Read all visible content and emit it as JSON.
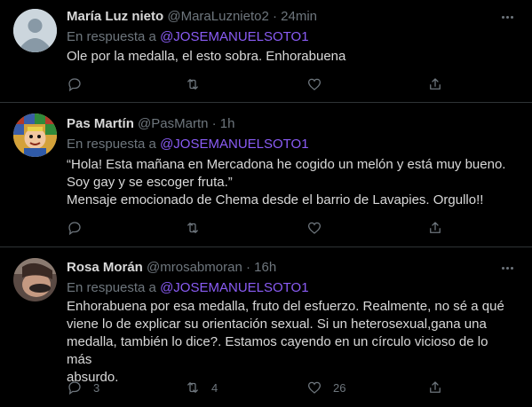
{
  "tweets": [
    {
      "name": "María Luz nieto",
      "handle": "@MaraLuznieto2",
      "separator": "·",
      "time": "24min",
      "reply_prefix": "En respuesta a",
      "reply_mention": "@JOSEMANUELSOTO1",
      "text_lines": [
        "Ole por la medalla, el esto sobra. Enhorabuena"
      ],
      "counts": {
        "reply": "",
        "retweet": "",
        "like": ""
      }
    },
    {
      "name": "Pas Martín",
      "handle": "@PasMartn",
      "separator": "·",
      "time": "1h",
      "reply_prefix": "En respuesta a",
      "reply_mention": "@JOSEMANUELSOTO1",
      "text_lines": [
        "“Hola! Esta mañana en Mercadona he cogido un melón y está muy bueno.",
        "Soy gay y se escoger fruta.”",
        "Mensaje emocionado de Chema desde el barrio de Lavapies. Orgullo!!"
      ],
      "counts": {
        "reply": "",
        "retweet": "",
        "like": ""
      }
    },
    {
      "name": "Rosa Morán",
      "handle": "@mrosabmoran",
      "separator": "·",
      "time": "16h",
      "reply_prefix": "En respuesta a",
      "reply_mention": "@JOSEMANUELSOTO1",
      "text_lines": [
        "Enhorabuena por esa medalla, fruto del esfuerzo. Realmente, no sé a qué",
        "viene lo de explicar su orientación sexual. Si un heterosexual,gana una",
        "medalla, también lo dice?. Estamos cayendo en un círculo vicioso de lo más",
        "absurdo."
      ],
      "counts": {
        "reply": "3",
        "retweet": "4",
        "like": "26"
      }
    }
  ],
  "colors": {
    "background": "#000000",
    "text": "#d9d9d9",
    "muted": "#6e767d",
    "mention": "#8a5cf5",
    "divider": "#2f3336"
  },
  "icons": [
    "more-icon",
    "reply-icon",
    "retweet-icon",
    "like-icon",
    "share-icon"
  ]
}
